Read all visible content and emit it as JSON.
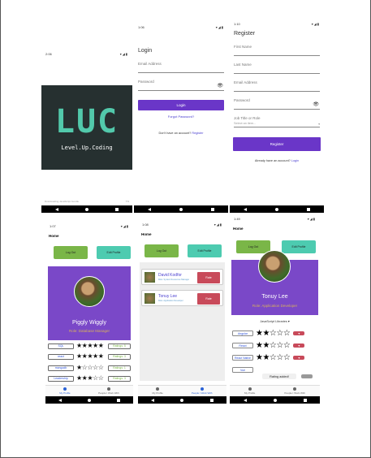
{
  "status_times": {
    "splash": "2:06",
    "login": "1:06",
    "register": "1:10",
    "home": "1:07",
    "people": "1:08",
    "rate": "1:49"
  },
  "splash": {
    "logo_text": "LUC",
    "tagline": "Level.Up.Coding",
    "footer_left": "Downloading JavaScript bundle",
    "footer_right": "7%"
  },
  "login": {
    "title": "Login",
    "email_placeholder": "Email Address",
    "password_placeholder": "Password",
    "login_button": "Login",
    "forgot_link": "Forgot Password?",
    "no_account_text": "Don't have an account?",
    "register_link": "Register"
  },
  "register": {
    "title": "Register",
    "first_name": "First Name",
    "last_name": "Last Name",
    "email": "Email Address",
    "password": "Password",
    "job_title": "Job Title or Role",
    "select_placeholder": "Select an item...",
    "register_button": "Register",
    "have_account_text": "Already have an account?",
    "login_link": "Login"
  },
  "home": {
    "title": "Home",
    "logout": "Log Out",
    "edit_profile": "Edit Profile",
    "name": "Piggly Wiggly",
    "role": "Role: Database Manager",
    "skills": [
      {
        "name": "SQL",
        "rating": "Ratings: 5",
        "stars": "★★★★★"
      },
      {
        "name": "react",
        "rating": "Ratings: 3",
        "stars": "★★★★★"
      },
      {
        "name": "mongodb",
        "rating": "Ratings: 1",
        "stars": "★☆☆☆☆"
      },
      {
        "name": "Leadership",
        "rating": "Ratings: 3",
        "stars": "★★★☆☆"
      }
    ]
  },
  "people": {
    "title": "Home",
    "logout": "Log Out",
    "edit_profile": "Edit Profile",
    "users": [
      {
        "name": "David Kodfor",
        "role": "Role: System Resources Manager",
        "rate": "Rate"
      },
      {
        "name": "Tonuy Lee",
        "role": "Role: Application Developer",
        "rate": "Rate"
      }
    ]
  },
  "rate": {
    "title": "Home",
    "logout": "Log Out",
    "edit_profile": "Edit Profile",
    "name": "Tonuy Lee",
    "role": "Role: Application Developer",
    "section": "JavaScript Libraries",
    "libs": [
      {
        "name": "Angular",
        "stars": "★★☆☆☆"
      },
      {
        "name": "React",
        "stars": "★★☆☆☆"
      },
      {
        "name": "React Native",
        "stars": "★★☆☆☆"
      },
      {
        "name": "Vue",
        "stars": ""
      }
    ],
    "toast": "Rating added!"
  },
  "tabs": {
    "profile": "My Profile",
    "people": "People I Work With"
  }
}
